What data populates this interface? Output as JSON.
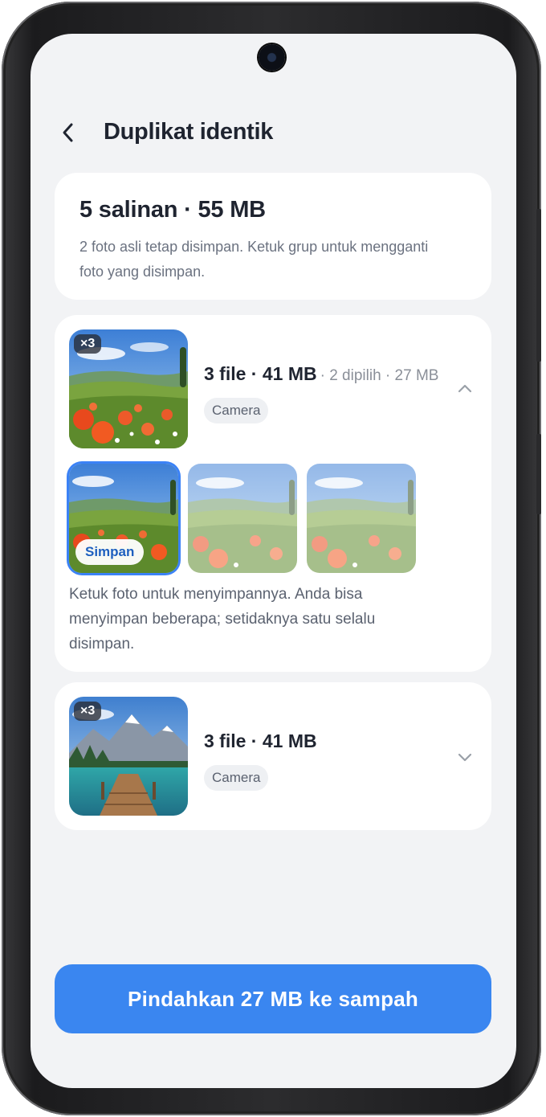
{
  "header": {
    "title": "Duplikat identik"
  },
  "summary": {
    "title": "5 salinan · 55 MB",
    "description": "2 foto asli tetap disimpan. Ketuk grup untuk mengganti foto yang disimpan."
  },
  "groups": [
    {
      "count_badge": "×3",
      "title": "3 file · 41 MB",
      "meta": "· 2 dipilih · 27 MB",
      "source": "Camera",
      "expanded": true,
      "chevron_icon": "chevron-up-icon",
      "photos": [
        {
          "badge": "Simpan",
          "kept": true
        },
        {
          "badge": "",
          "kept": false
        },
        {
          "badge": "",
          "kept": false
        }
      ],
      "hint": "Ketuk foto untuk menyimpannya. Anda bisa menyimpan beberapa; setidaknya satu selalu disimpan."
    },
    {
      "count_badge": "×3",
      "title": "3 file · 41 MB",
      "source": "Camera",
      "expanded": false,
      "chevron_icon": "chevron-down-icon"
    }
  ],
  "cta": {
    "label": "Pindahkan 27 MB ke sampah"
  },
  "colors": {
    "accent": "#3a86f0",
    "selected_border": "#3b82f6",
    "background": "#f2f3f5"
  }
}
